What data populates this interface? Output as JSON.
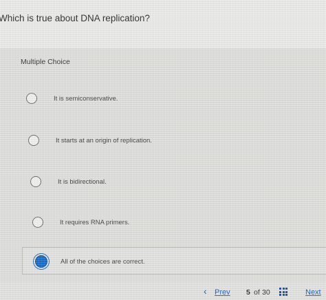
{
  "question": {
    "text": "Which is true about DNA replication?"
  },
  "answer_type": "Multiple Choice",
  "options": [
    {
      "label": "It is semiconservative.",
      "selected": false
    },
    {
      "label": "It starts at an origin of replication.",
      "selected": false
    },
    {
      "label": "It is bidirectional.",
      "selected": false
    },
    {
      "label": "It requires RNA primers.",
      "selected": false
    },
    {
      "label": "All of the choices are correct.",
      "selected": true
    }
  ],
  "footer": {
    "prev_label": "Prev",
    "current_page": "5",
    "of_label": "of",
    "total_pages": "30",
    "next_label": "Next",
    "grid_icon": "grid-icon",
    "prev_icon": "chevron-left-icon"
  },
  "colors": {
    "selected_radio": "#1b6fcf",
    "link": "#1f5fb8"
  }
}
